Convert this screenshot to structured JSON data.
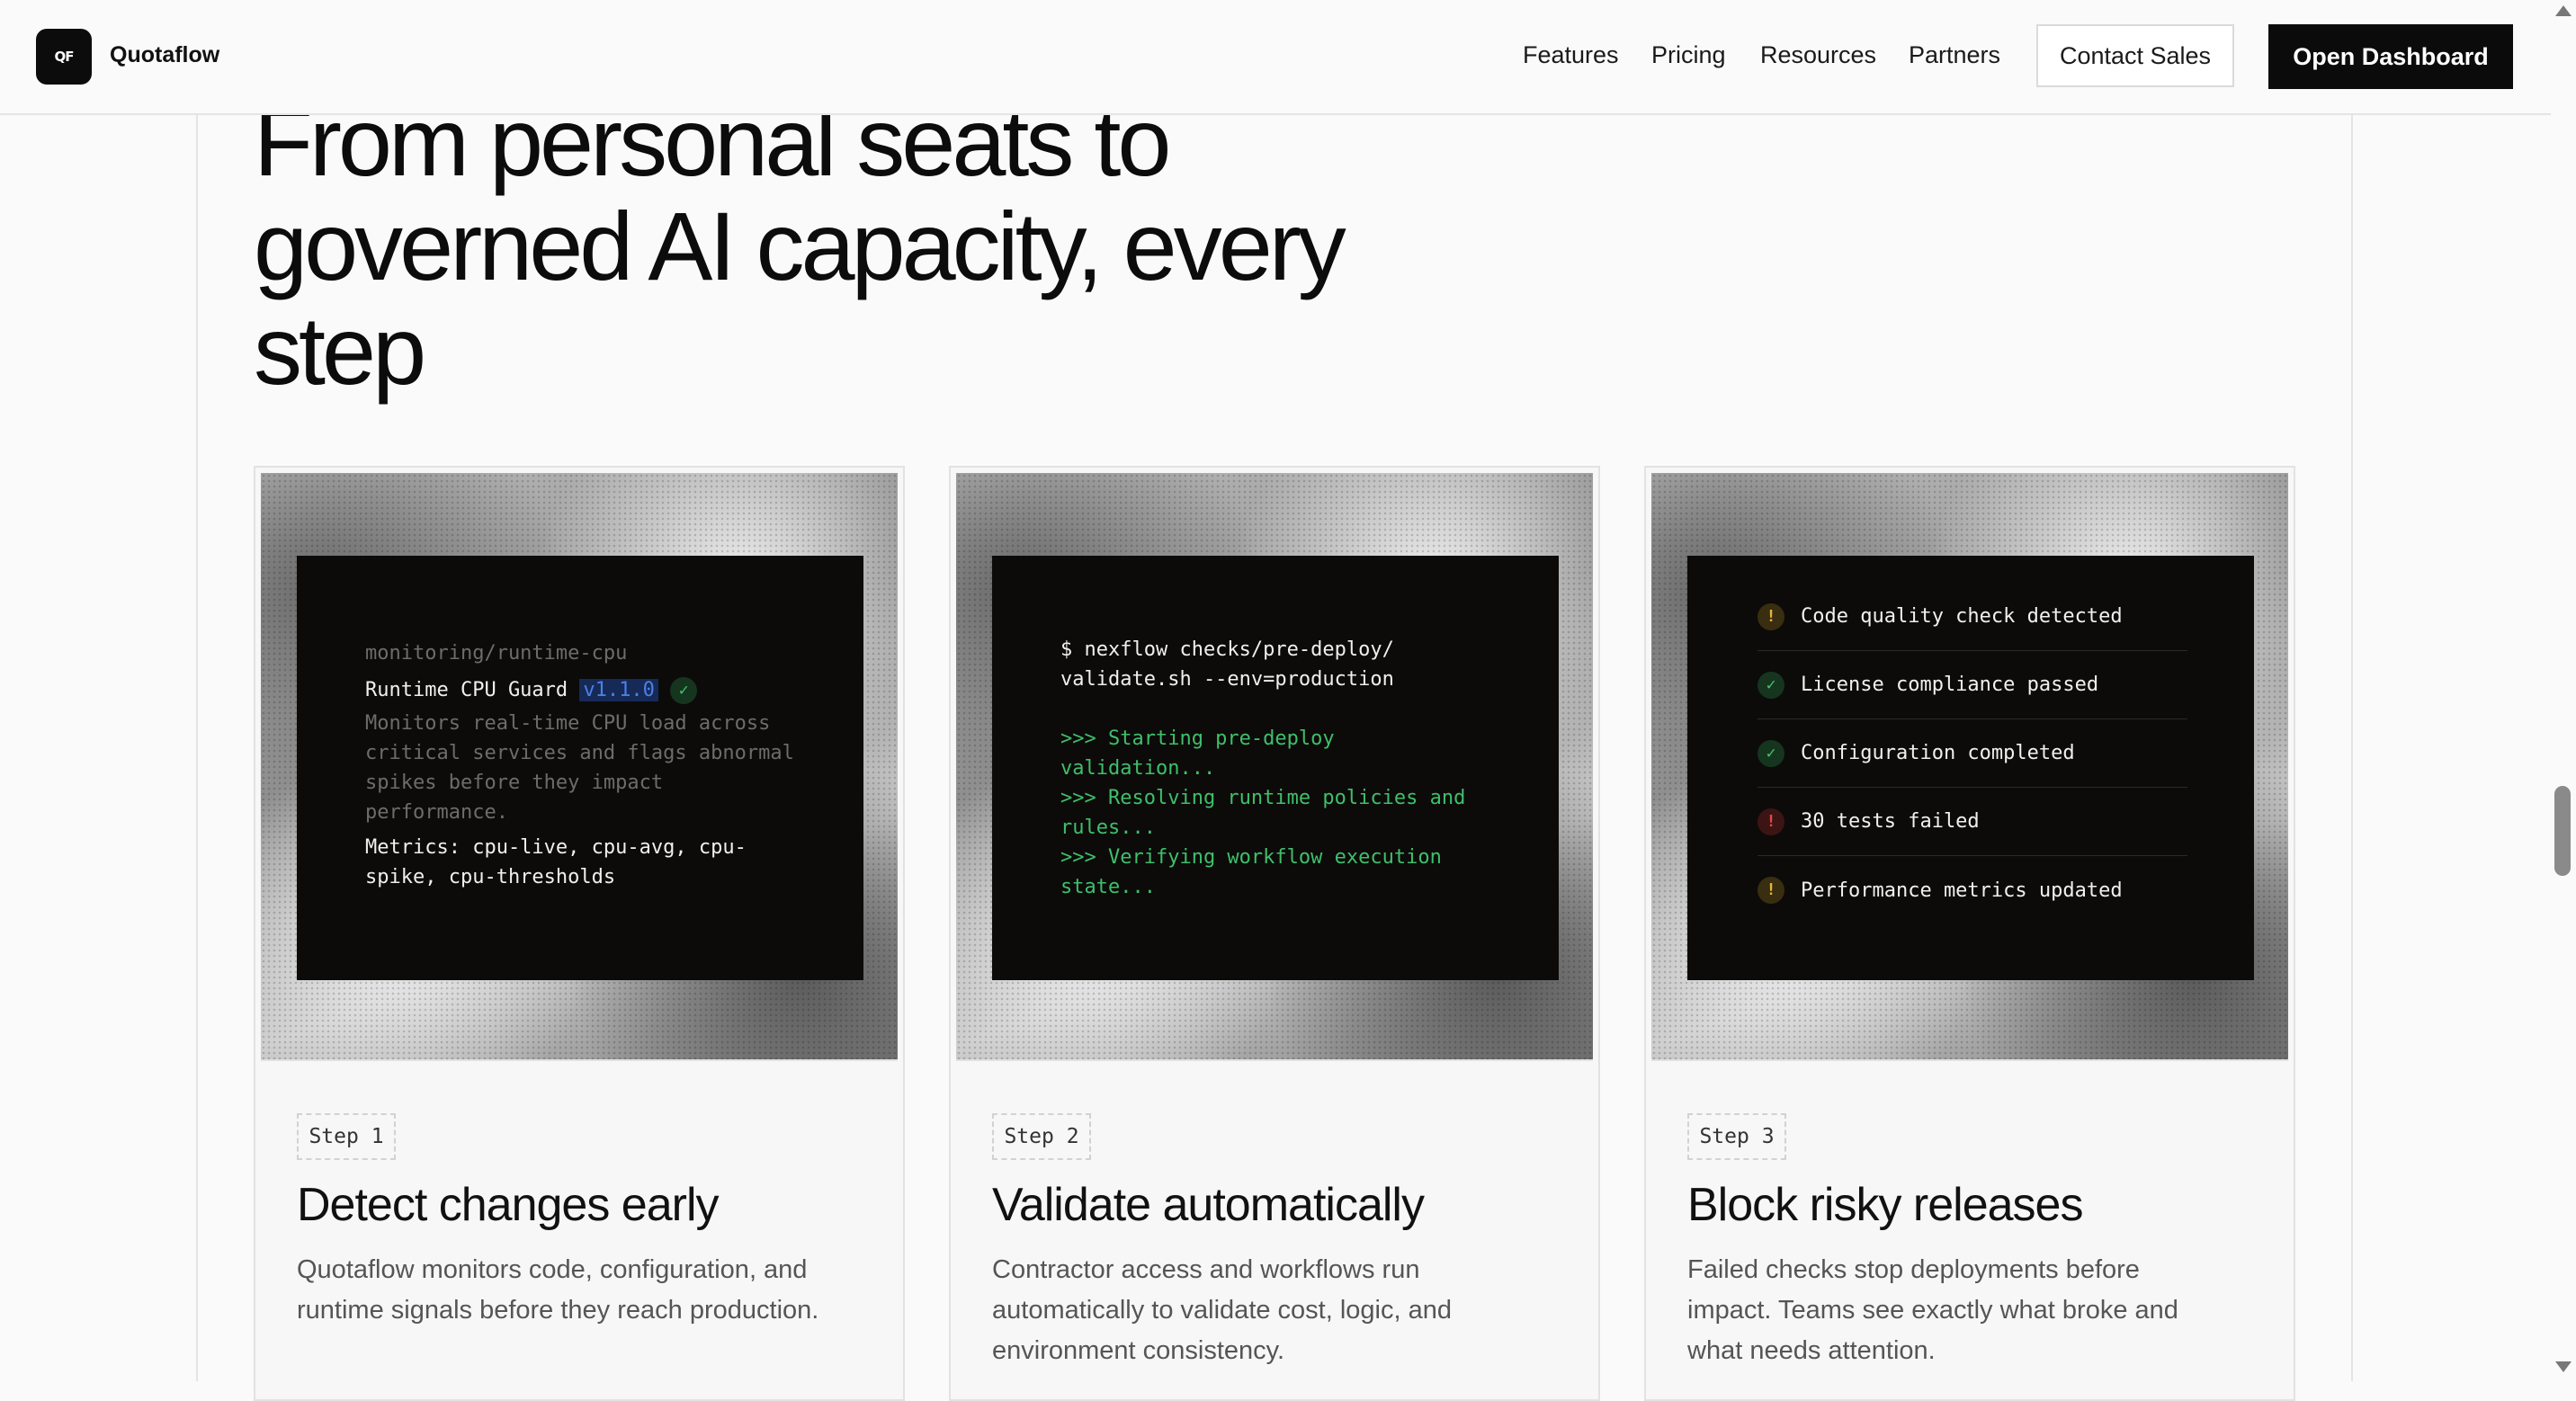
{
  "header": {
    "logo_mark": "QF",
    "brand": "Quotaflow",
    "nav": [
      "Features",
      "Pricing",
      "Resources",
      "Partners"
    ],
    "contact_label": "Contact Sales",
    "dashboard_label": "Open Dashboard"
  },
  "hero": {
    "title_lines": [
      "From personal seats to",
      "governed AI capacity, every",
      "step"
    ]
  },
  "cards": [
    {
      "step": "Step 1",
      "title": "Detect changes early",
      "description": "Quotaflow monitors code, configuration, and runtime signals before they reach production.",
      "terminal": {
        "path": "monitoring/runtime-cpu",
        "name": "Runtime CPU Guard",
        "version": "v1.1.0",
        "desc_lines": [
          "Monitors real-time CPU load across",
          "critical services and flags abnormal",
          "spikes before they impact",
          "performance."
        ],
        "metrics_lines": [
          "Metrics: cpu-live, cpu-avg, cpu-",
          "spike, cpu-thresholds"
        ]
      }
    },
    {
      "step": "Step 2",
      "title": "Validate automatically",
      "description": "Contractor access and workflows run automatically to validate cost, logic, and environment consistency.",
      "terminal": {
        "command_lines": [
          "$ nexflow checks/pre-deploy/",
          "validate.sh --env=production"
        ],
        "output_lines": [
          ">>> Starting pre-deploy",
          "validation...",
          ">>> Resolving runtime policies and",
          "rules...",
          ">>> Verifying workflow execution",
          "state..."
        ]
      }
    },
    {
      "step": "Step 3",
      "title": "Block risky releases",
      "description": "Failed checks stop deployments before impact. Teams see exactly what broke and what needs attention.",
      "checks": [
        {
          "status": "warning",
          "label": "Code quality check detected"
        },
        {
          "status": "ok",
          "label": "License compliance passed"
        },
        {
          "status": "ok",
          "label": "Configuration completed"
        },
        {
          "status": "error",
          "label": "30 tests failed"
        },
        {
          "status": "warning",
          "label": "Performance metrics updated"
        }
      ]
    }
  ]
}
